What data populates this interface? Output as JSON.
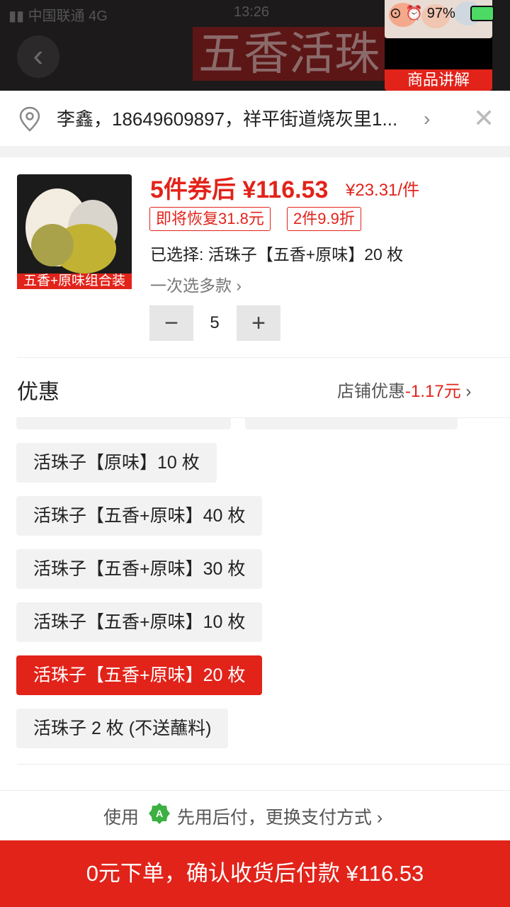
{
  "status_bar": {
    "carrier": "中国联通",
    "network": "4G",
    "time": "13:26",
    "battery": "97%"
  },
  "header": {
    "back_icon": "chevron-left-icon",
    "banner_text": "五香活珠",
    "live_label": "商品讲解"
  },
  "address": {
    "text": "李鑫，18649609897，祥平街道烧灰里1...",
    "pin_icon": "location-pin-icon",
    "close_icon": "close-icon"
  },
  "product": {
    "image_caption": "五香+原味组合装",
    "price_main": "5件券后 ¥116.53",
    "price_unit": "¥23.31/件",
    "tags": [
      "即将恢复31.8元",
      "2件9.9折"
    ],
    "selected": "已选择: 活珠子【五香+原味】20 枚",
    "multi_select": "一次选多款",
    "quantity": "5",
    "minus": "−",
    "plus": "+"
  },
  "discount": {
    "title": "优惠",
    "label": "店铺优惠",
    "amount": "-1.17元"
  },
  "variants": [
    {
      "label": "活珠子【原味】10 枚",
      "selected": false
    },
    {
      "label": "活珠子【五香+原味】40 枚",
      "selected": false
    },
    {
      "label": "活珠子【五香+原味】30 枚",
      "selected": false
    },
    {
      "label": "活珠子【五香+原味】10 枚",
      "selected": false
    },
    {
      "label": "活珠子【五香+原味】20 枚",
      "selected": true
    },
    {
      "label": "活珠子 2 枚 (不送蘸料)",
      "selected": false
    }
  ],
  "payment": {
    "prefix": "使用",
    "method": "先用后付，更换支付方式",
    "icon": "pay-later-icon",
    "icon_color": "#3cb043"
  },
  "order_button": "0元下单，确认收货后付款 ¥116.53",
  "colors": {
    "accent": "#e2231a"
  }
}
